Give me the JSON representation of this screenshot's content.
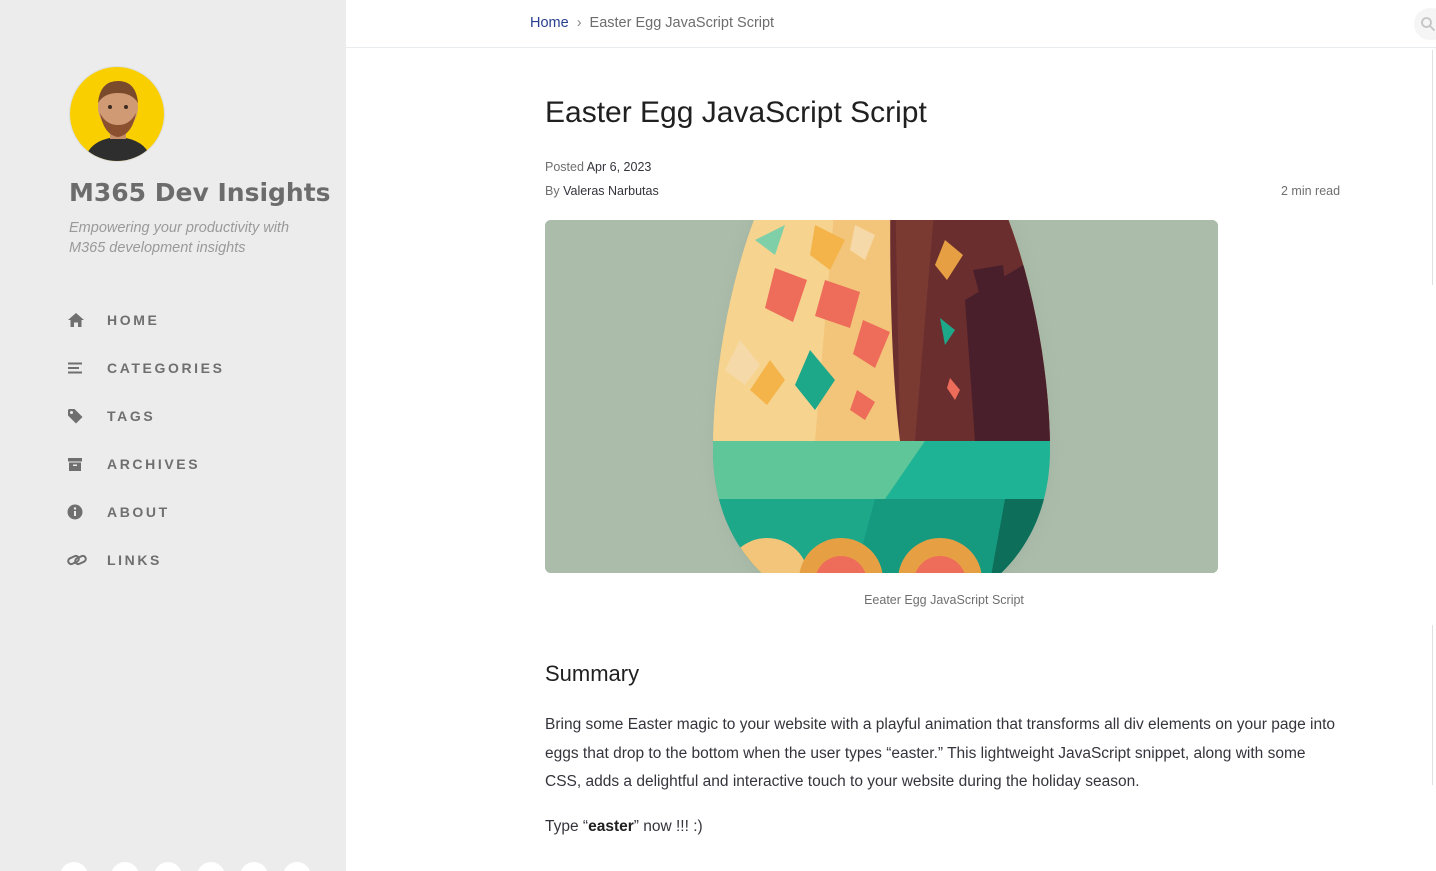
{
  "sidebar": {
    "avatar_icon": "author-avatar",
    "site_title": "M365 Dev Insights",
    "site_subtitle": "Empowering your productivity with M365 development insights",
    "nav_items": [
      {
        "label": "HOME",
        "icon": "home-icon"
      },
      {
        "label": "CATEGORIES",
        "icon": "list-icon"
      },
      {
        "label": "TAGS",
        "icon": "tag-icon"
      },
      {
        "label": "ARCHIVES",
        "icon": "archive-icon"
      },
      {
        "label": "ABOUT",
        "icon": "info-icon"
      },
      {
        "label": "LINKS",
        "icon": "link-icon"
      }
    ]
  },
  "topbar": {
    "breadcrumb_home": "Home",
    "breadcrumb_separator": "›",
    "breadcrumb_current": "Easter Egg JavaScript Script",
    "search_icon": "search-icon"
  },
  "post": {
    "title": "Easter Egg JavaScript Script",
    "posted_prefix": "Posted",
    "posted_date": "Apr 6, 2023",
    "author_prefix": "By",
    "author": "Valeras Narbutas",
    "read_time": "2 min read",
    "image_caption": "Eeater Egg JavaScript Script",
    "summary_heading": "Summary",
    "summary_text": "Bring some Easter magic to your website with a playful animation that transforms all div elements on your page into eggs that drop to the bottom when the user types “easter.” This lightweight JavaScript snippet, along with some CSS, adds a delightful and interactive touch to your website during the holiday season.",
    "easter_prefix": "Type “",
    "easter_word": "easter",
    "easter_suffix": "” now !!! :)"
  },
  "colors": {
    "sidebar_bg": "#ececec",
    "link": "#2a408e",
    "hero_bg": "#abbcaa",
    "avatar_bg": "#f9cf00"
  }
}
